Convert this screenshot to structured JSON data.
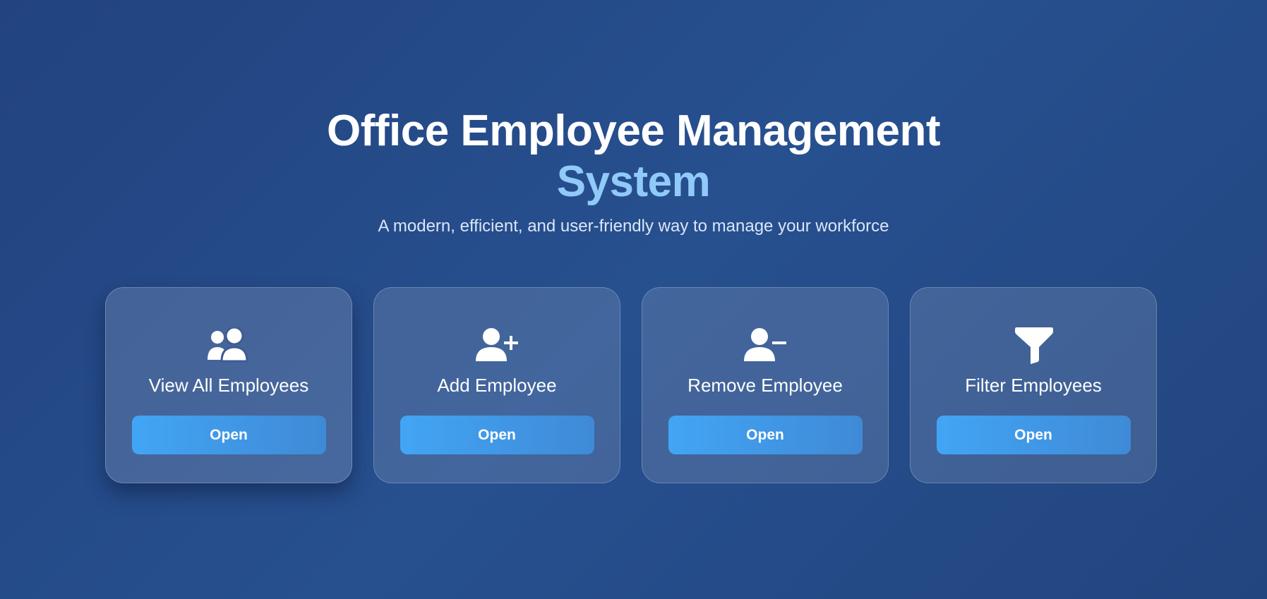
{
  "header": {
    "title_line1": "Office Employee Management",
    "title_line2": "System",
    "subtitle": "A modern, efficient, and user-friendly way to manage your workforce"
  },
  "cards": [
    {
      "label": "View All Employees",
      "icon": "users-icon",
      "button_label": "Open"
    },
    {
      "label": "Add Employee",
      "icon": "user-plus-icon",
      "button_label": "Open"
    },
    {
      "label": "Remove Employee",
      "icon": "user-minus-icon",
      "button_label": "Open"
    },
    {
      "label": "Filter Employees",
      "icon": "filter-icon",
      "button_label": "Open"
    }
  ],
  "colors": {
    "background": "#24488a",
    "accent": "#90caf9",
    "button": "#42a5f5",
    "text": "#ffffff"
  }
}
